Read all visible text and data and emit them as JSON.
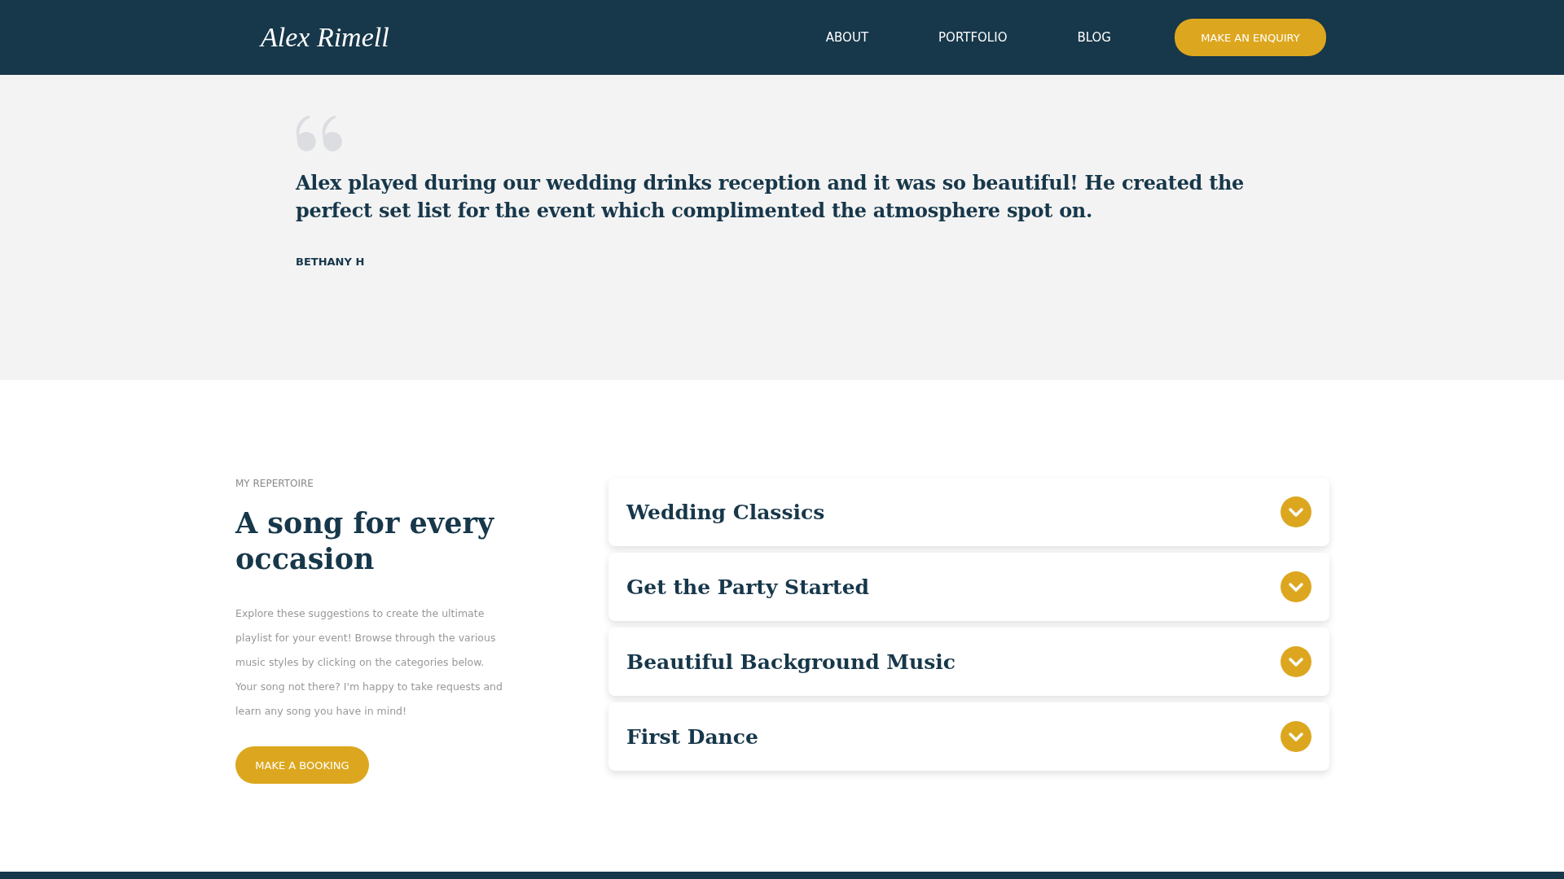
{
  "header": {
    "logo": "Alex Rimell",
    "nav": [
      {
        "label": "ABOUT"
      },
      {
        "label": "PORTFOLIO"
      },
      {
        "label": "BLOG"
      }
    ],
    "cta": "MAKE AN ENQUIRY"
  },
  "testimonial": {
    "quote": "Alex played during our wedding drinks reception and it was so beautiful! He created the perfect set list for the event which complimented the atmosphere spot on.",
    "author": "BETHANY H"
  },
  "repertoire": {
    "eyebrow": "MY REPERTOIRE",
    "heading": "A song for every occasion",
    "body": "Explore these suggestions to create the ultimate playlist for your event! Browse through the various music styles by clicking on the categories below. Your song not there? I'm happy to take requests and learn any song you have in mind!",
    "button": "MAKE A BOOKING",
    "categories": [
      {
        "title": "Wedding Classics",
        "expanded": false
      },
      {
        "title": "Get the Party Started",
        "expanded": false
      },
      {
        "title": "Beautiful Background Music",
        "expanded": false
      },
      {
        "title": "First Dance",
        "expanded": false
      }
    ]
  }
}
